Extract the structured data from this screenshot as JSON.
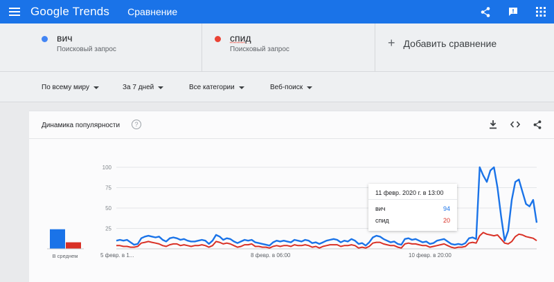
{
  "topbar": {
    "logo_google": "Google",
    "logo_trends": "Trends",
    "page_name": "Сравнение"
  },
  "terms": [
    {
      "name": "вич",
      "subtitle": "Поисковый запрос",
      "color": "#4285f4"
    },
    {
      "name": "спид",
      "subtitle": "Поисковый запрос",
      "color": "#ea4335"
    }
  ],
  "add_comparison": "Добавить сравнение",
  "filters": {
    "region": "По всему миру",
    "period": "За 7 дней",
    "category": "Все категории",
    "search_type": "Веб-поиск"
  },
  "card": {
    "title": "Динамика популярности",
    "help": "?"
  },
  "tooltip": {
    "date": "11 февр. 2020 г. в 13:00",
    "rows": [
      {
        "name": "вич",
        "value": "94",
        "color": "#1a73e8"
      },
      {
        "name": "спид",
        "value": "20",
        "color": "#d93025"
      }
    ]
  },
  "chart_data": {
    "type": "line",
    "average_label": "В среднем",
    "average_values": [
      {
        "name": "вич",
        "value": 24
      },
      {
        "name": "спид",
        "value": 8
      }
    ],
    "y_ticks": [
      25,
      50,
      75,
      100
    ],
    "ylim": [
      0,
      100
    ],
    "x_ticks": [
      "5 февр. в 1...",
      "8 февр. в 06:00",
      "10 февр. в 20:00"
    ],
    "series": [
      {
        "name": "вич",
        "color": "#1a73e8",
        "values": [
          10,
          11,
          10,
          11,
          8,
          5,
          6,
          13,
          15,
          16,
          15,
          14,
          15,
          11,
          9,
          13,
          14,
          13,
          11,
          12,
          10,
          9,
          9,
          10,
          11,
          10,
          6,
          10,
          17,
          15,
          11,
          13,
          12,
          9,
          7,
          9,
          11,
          10,
          11,
          8,
          7,
          6,
          5,
          4,
          8,
          10,
          9,
          10,
          9,
          8,
          11,
          10,
          9,
          11,
          10,
          7,
          8,
          6,
          8,
          10,
          11,
          12,
          11,
          8,
          10,
          9,
          12,
          10,
          6,
          7,
          4,
          8,
          14,
          16,
          15,
          12,
          10,
          8,
          9,
          6,
          5,
          12,
          13,
          11,
          12,
          10,
          8,
          9,
          6,
          7,
          10,
          11,
          12,
          9,
          6,
          5,
          6,
          5,
          7,
          13,
          14,
          12,
          100,
          90,
          82,
          96,
          100,
          75,
          40,
          10,
          22,
          60,
          82,
          85,
          70,
          55,
          52,
          60,
          32
        ]
      },
      {
        "name": "спид",
        "color": "#d93025",
        "values": [
          4,
          4,
          3,
          3,
          2,
          2,
          3,
          7,
          8,
          9,
          8,
          7,
          6,
          4,
          3,
          5,
          6,
          6,
          4,
          5,
          4,
          3,
          4,
          4,
          5,
          4,
          2,
          4,
          9,
          8,
          6,
          7,
          6,
          4,
          2,
          3,
          5,
          5,
          6,
          3,
          3,
          2,
          2,
          1,
          3,
          4,
          3,
          4,
          4,
          3,
          5,
          4,
          4,
          5,
          4,
          2,
          3,
          1,
          3,
          4,
          5,
          5,
          5,
          3,
          4,
          4,
          5,
          4,
          1,
          2,
          1,
          3,
          7,
          8,
          8,
          6,
          5,
          4,
          4,
          2,
          1,
          6,
          7,
          6,
          6,
          5,
          4,
          4,
          2,
          3,
          4,
          5,
          6,
          4,
          2,
          1,
          2,
          2,
          3,
          7,
          8,
          7,
          16,
          20,
          18,
          17,
          16,
          17,
          12,
          7,
          6,
          9,
          15,
          18,
          17,
          15,
          14,
          13,
          10
        ]
      }
    ]
  }
}
